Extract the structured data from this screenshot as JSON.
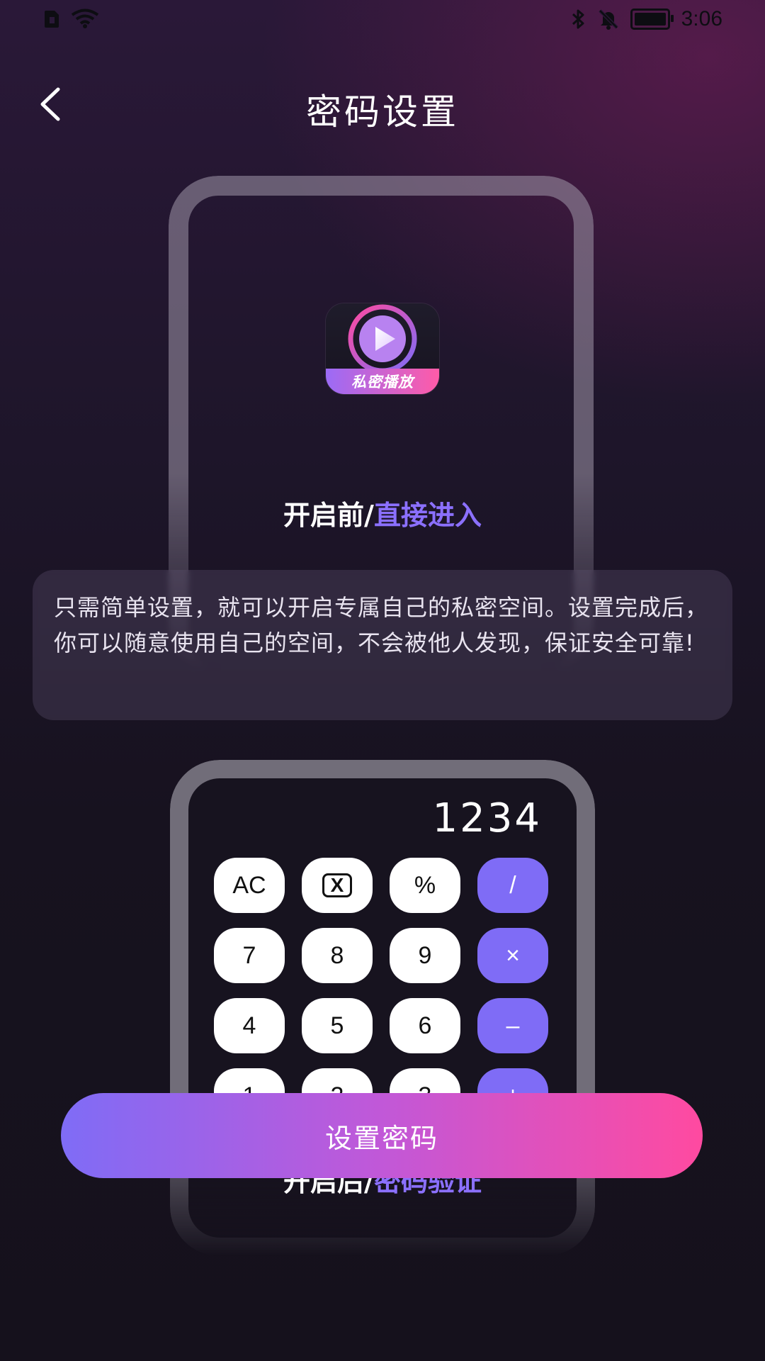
{
  "status_bar": {
    "time": "3:06",
    "icons": [
      "sim-icon",
      "wifi-icon",
      "bluetooth-icon",
      "bell-off-icon",
      "battery-icon"
    ]
  },
  "header": {
    "title": "密码设置"
  },
  "before_section": {
    "app_label": "私密播放",
    "caption_prefix": "开启前/",
    "caption_accent": "直接进入"
  },
  "info_card": {
    "text": "只需简单设置，就可以开启专属自己的私密空间。设置完成后，你可以随意使用自己的空间，不会被他人发现，保证安全可靠!"
  },
  "calculator": {
    "display": "1234",
    "keys": [
      {
        "label": "AC"
      },
      {
        "label": "X"
      },
      {
        "label": "%"
      },
      {
        "label": "/"
      },
      {
        "label": "7"
      },
      {
        "label": "8"
      },
      {
        "label": "9"
      },
      {
        "label": "×"
      },
      {
        "label": "4"
      },
      {
        "label": "5"
      },
      {
        "label": "6"
      },
      {
        "label": "–"
      },
      {
        "label": "1"
      },
      {
        "label": "2"
      },
      {
        "label": "3"
      },
      {
        "label": "+"
      }
    ]
  },
  "after_section": {
    "caption_prefix": "开启后/",
    "caption_accent": "密码验证"
  },
  "primary_button": {
    "label": "设置密码"
  },
  "colors": {
    "accent": "#8b70ff",
    "gradient_start": "#7f6cf6",
    "gradient_end": "#ff4aa0"
  }
}
